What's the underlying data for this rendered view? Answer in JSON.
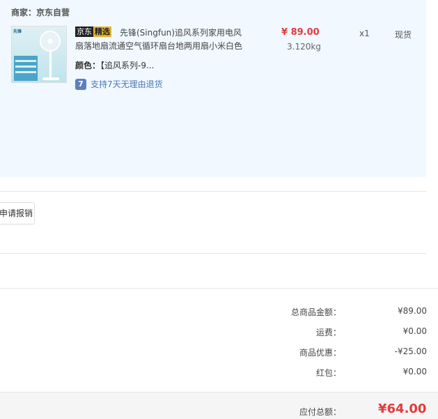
{
  "seller": {
    "label": "商家：京东自营"
  },
  "product": {
    "tag_part1": "京东",
    "tag_part2": "精选",
    "name": "先锋(Singfun)追风系列家用电风扇落地扇流通空气循环扇台地两用扇小米白色",
    "color_label": "颜色：",
    "color_value": "【追风系列-9...",
    "return_icon": "7",
    "return_text": "支持7天无理由退货",
    "price": "¥ 89.00",
    "weight": "3.120kg",
    "quantity": "x1",
    "stock": "现货",
    "image_brand": "先锋"
  },
  "actions": {
    "report_label": "申请报销"
  },
  "summary": {
    "rows": [
      {
        "label": "总商品金额：",
        "value": "¥89.00"
      },
      {
        "label": "运费：",
        "value": "¥0.00"
      },
      {
        "label": "商品优惠：",
        "value": "-¥25.00"
      },
      {
        "label": "红包：",
        "value": "¥0.00"
      }
    ],
    "total_label": "应付总额：",
    "total_value": "¥64.00"
  },
  "colors": {
    "price_red": "#e4393c",
    "panel_bg": "#f1f8ff",
    "link_blue": "#4a78b8"
  }
}
